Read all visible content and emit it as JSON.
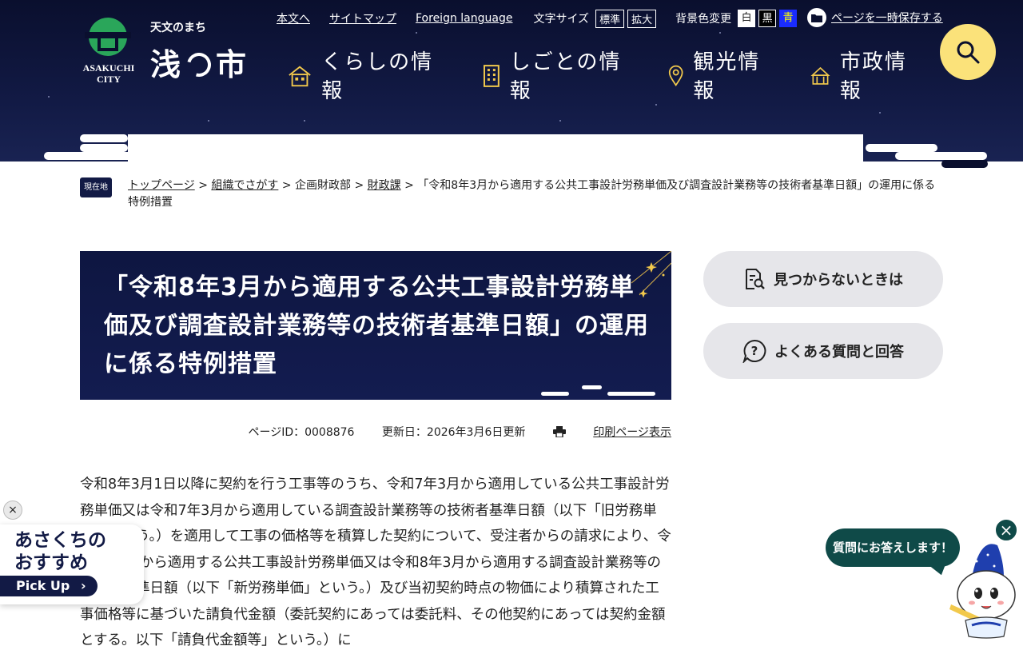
{
  "header": {
    "logo_subtitle": "天文のまち",
    "logo_city_en_1": "ASAKUCHI",
    "logo_city_en_2": "CITY",
    "logo_name_1": "浅",
    "logo_name_2": "市",
    "utility_links": [
      "本文へ",
      "サイトマップ",
      "Foreign language"
    ],
    "font_size_label": "文字サイズ",
    "font_size_options": [
      "標準",
      "拡大"
    ],
    "bg_color_label": "背景色変更",
    "bg_color_options": [
      {
        "label": "白",
        "bg": "#ffffff",
        "fg": "#222222"
      },
      {
        "label": "黒",
        "bg": "#000000",
        "fg": "#ffffff"
      },
      {
        "label": "青",
        "bg": "#1a2cff",
        "fg": "#ffff00"
      }
    ],
    "save_page_label": "ページを一時保存する",
    "search_icon": "search-icon",
    "nav": [
      {
        "label": "くらしの情報",
        "icon": "house-icon"
      },
      {
        "label": "しごとの情報",
        "icon": "building-icon"
      },
      {
        "label": "観光情報",
        "icon": "map-pin-icon"
      },
      {
        "label": "市政情報",
        "icon": "city-hall-icon"
      }
    ]
  },
  "breadcrumb": {
    "badge": "現在地",
    "items": [
      "トップページ",
      "組織でさがす",
      "企画財政部",
      "財政課"
    ],
    "separator": ">",
    "current": "「令和8年3月から適用する公共工事設計労務単価及び調査設計業務等の技術者基準日額」の運用に係る特例措置"
  },
  "page": {
    "title": "「令和8年3月から適用する公共工事設計労務単価及び調査設計業務等の技術者基準日額」の運用に係る特例措置",
    "page_id": "ページID：0008876",
    "updated": "更新日：2026年3月6日更新",
    "print_label": "印刷ページ表示",
    "body": "令和8年3月1日以降に契約を行う工事等のうち、令和7年3月から適用している公共工事設計労務単価又は令和7年3月から適用している調査設計業務等の技術者基準日額（以下「旧労務単価」という。）を適用して工事の価格等を積算した契約について、受注者からの請求により、令和8年3月から適用する公共工事設計労務単価又は令和8年3月から適用する調査設計業務等の技術者基準日額（以下「新労務単価」という。）及び当初契約時点の物価により積算された工事価格等に基づいた請負代金額（委託契約にあっては委託料、その他契約にあっては契約金額とする。以下「請負代金額等」という。）に"
  },
  "side": {
    "not_found_label": "見つからないときは",
    "faq_label": "よくある質問と回答"
  },
  "pickup": {
    "title_1": "あさくちの",
    "title_2": "おすすめ",
    "button": "Pick Up",
    "close": "×"
  },
  "chatbot": {
    "bubble": "質問にお答えします！",
    "close": "×"
  }
}
